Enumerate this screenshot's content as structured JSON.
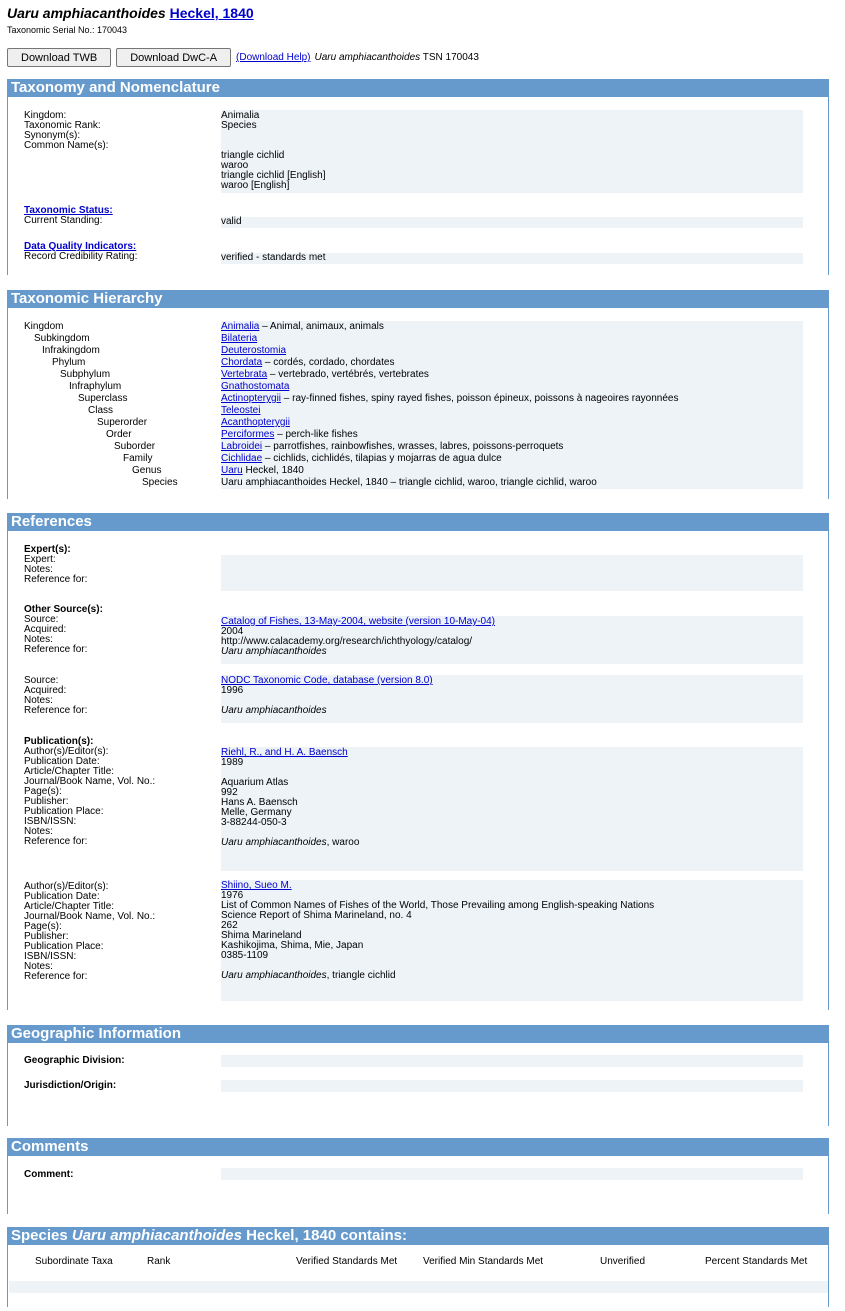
{
  "title": {
    "species": "Uaru amphiacanthoides",
    "author": "Heckel, 1840"
  },
  "tsn_line": "Taxonomic Serial No.: 170043",
  "buttons": {
    "download_twb": "Download TWB",
    "download_dwca": "Download DwC-A",
    "help": "(Download Help)",
    "tsn_species": "Uaru amphiacanthoides",
    "tsn_text": "TSN 170043"
  },
  "taxonomy": {
    "header": "Taxonomy and Nomenclature",
    "kingdom_label": "Kingdom:",
    "kingdom": "Animalia",
    "rank_label": "Taxonomic Rank:",
    "rank": "Species",
    "synonyms_label": "Synonym(s):",
    "common_label": "Common Name(s):",
    "common_names": [
      "triangle cichlid",
      "waroo",
      "triangle cichlid [English]",
      "waroo [English]"
    ],
    "status_link": "Taxonomic Status:",
    "standing_label": "Current Standing:",
    "standing": "valid",
    "dqi_link": "Data Quality Indicators:",
    "credibility_label": "Record Credibility Rating:",
    "credibility": "verified - standards met"
  },
  "hierarchy": {
    "header": "Taxonomic Hierarchy",
    "rows": [
      {
        "rank": "Kingdom",
        "name": "Animalia",
        "link": true,
        "rest": " – Animal, animaux, animals"
      },
      {
        "rank": "Subkingdom",
        "name": "Bilateria",
        "link": true,
        "rest": ""
      },
      {
        "rank": "Infrakingdom",
        "name": "Deuterostomia",
        "link": true,
        "rest": ""
      },
      {
        "rank": "Phylum",
        "name": "Chordata",
        "link": true,
        "rest": " – cordés, cordado, chordates"
      },
      {
        "rank": "Subphylum",
        "name": "Vertebrata",
        "link": true,
        "rest": " – vertebrado, vertébrés, vertebrates"
      },
      {
        "rank": "Infraphylum",
        "name": "Gnathostomata",
        "link": true,
        "rest": ""
      },
      {
        "rank": "Superclass",
        "name": "Actinopterygii",
        "link": true,
        "rest": " – ray-finned fishes, spiny rayed fishes, poisson épineux, poissons à nageoires rayonnées"
      },
      {
        "rank": "Class",
        "name": "Teleostei",
        "link": true,
        "rest": ""
      },
      {
        "rank": "Superorder",
        "name": "Acanthopterygii",
        "link": true,
        "rest": ""
      },
      {
        "rank": "Order",
        "name": "Perciformes",
        "link": true,
        "rest": " – perch-like fishes"
      },
      {
        "rank": "Suborder",
        "name": "Labroidei",
        "link": true,
        "rest": " – parrotfishes, rainbowfishes, wrasses, labres, poissons-perroquets"
      },
      {
        "rank": "Family",
        "name": "Cichlidae",
        "link": true,
        "rest": " – cichlids, cichlidés, tilapias y mojarras de agua dulce"
      },
      {
        "rank": "Genus",
        "name": "Uaru",
        "link": true,
        "rest": " Heckel, 1840"
      },
      {
        "rank": "Species",
        "name": "",
        "link": false,
        "rest": "Uaru amphiacanthoides Heckel, 1840 – triangle cichlid, waroo, triangle cichlid, waroo"
      }
    ]
  },
  "references": {
    "header": "References",
    "expert_heading": "Expert(s):",
    "expert_labels": [
      "Expert:",
      "Notes:",
      "Reference for:"
    ],
    "other_heading": "Other Source(s):",
    "src1": {
      "labels": [
        "Source:",
        "Acquired:",
        "Notes:",
        "Reference for:"
      ],
      "source": "Catalog of Fishes, 13-May-2004, website (version 10-May-04)",
      "acquired": "2004",
      "notes": "http://www.calacademy.org/research/ichthyology/catalog/",
      "ref_for": "Uaru amphiacanthoides"
    },
    "src2": {
      "labels": [
        "Source:",
        "Acquired:",
        "Notes:",
        "Reference for:"
      ],
      "source": "NODC Taxonomic Code, database (version 8.0)",
      "acquired": "1996",
      "ref_for": "Uaru amphiacanthoides"
    },
    "pub_heading": "Publication(s):",
    "pub_labels": [
      "Author(s)/Editor(s):",
      "Publication Date:",
      "Article/Chapter Title:",
      "Journal/Book Name, Vol. No.:",
      "Page(s):",
      "Publisher:",
      "Publication Place:",
      "ISBN/ISSN:",
      "Notes:",
      "Reference for:"
    ],
    "pub1": {
      "author": "Riehl, R., and H. A. Baensch",
      "date": "1989",
      "title": "",
      "journal": "Aquarium Atlas",
      "pages": "992",
      "publisher": "Hans A. Baensch",
      "place": "Melle, Germany",
      "isbn": "3-88244-050-3",
      "notes": "",
      "ref_for_sp": "Uaru amphiacanthoides",
      "ref_for_rest": ", waroo"
    },
    "pub2": {
      "author": "Shiino, Sueo M.",
      "date": "1976",
      "title": "List of Common Names of Fishes of the World, Those Prevailing among English-speaking Nations",
      "journal": "Science Report of Shima Marineland, no. 4",
      "pages": "262",
      "publisher": "Shima Marineland",
      "place": "Kashikojima, Shima, Mie, Japan",
      "isbn": "0385-1109",
      "notes": "",
      "ref_for_sp": "Uaru amphiacanthoides",
      "ref_for_rest": ", triangle cichlid"
    }
  },
  "geo": {
    "header": "Geographic Information",
    "division_label": "Geographic Division:",
    "jurisdiction_label": "Jurisdiction/Origin:"
  },
  "comments": {
    "header": "Comments",
    "comment_label": "Comment:"
  },
  "contains": {
    "header_pre": "Species ",
    "header_sp": "Uaru amphiacanthoides",
    "header_post": " Heckel, 1840 contains:",
    "columns": [
      "Subordinate Taxa",
      "Rank",
      "Verified Standards Met",
      "Verified Min Standards Met",
      "Unverified",
      "Percent Standards Met"
    ]
  }
}
